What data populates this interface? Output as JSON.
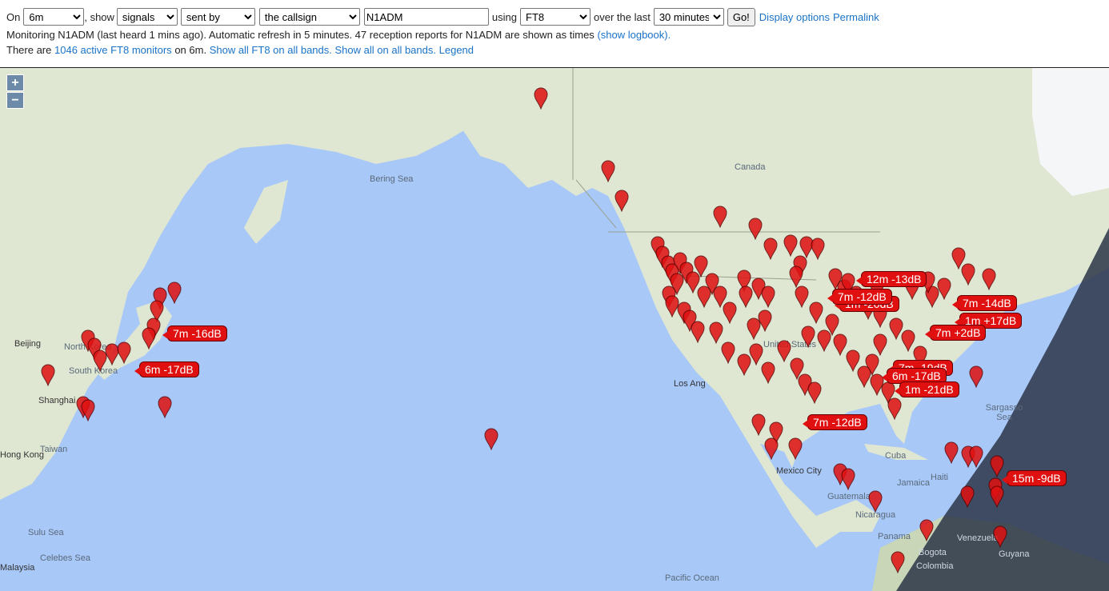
{
  "toolbar": {
    "on_label": "On",
    "band_value": "6m",
    "show_label": ", show",
    "mode_value": "signals",
    "direction_value": "sent by",
    "target_value": "the callsign",
    "callsign_value": "N1ADM",
    "using_label": "using",
    "protocol_value": "FT8",
    "over_label": "over the last",
    "period_value": "30 minutes",
    "go_label": "Go!",
    "display_options_label": "Display options",
    "permalink_label": "Permalink"
  },
  "status": {
    "line1_text": "Monitoring N1ADM (last heard 1 mins ago). Automatic refresh in 5 minutes. 47 reception reports for N1ADM are shown as times",
    "show_logbook_label": "(show logbook).",
    "line2_prefix": "There are",
    "active_monitors_link": "1046 active FT8 monitors",
    "line2_mid": "on 6m.",
    "show_all_ft8_link": "Show all FT8 on all bands.",
    "show_all_link": "Show all on all bands.",
    "legend_link": "Legend"
  },
  "map": {
    "zoom_in": "+",
    "zoom_out": "−",
    "labels": [
      "Canada",
      "Bering Sea",
      "Beijing",
      "Shanghai",
      "Hong Kong",
      "Taiwan",
      "Sulu Sea",
      "Celebes Sea",
      "Malaysia",
      "Los Ang",
      "Mexico City",
      "Cuba",
      "Haiti",
      "Jamaica",
      "Sargasso Sea",
      "Panama",
      "Venezuela",
      "Colombia",
      "Guyana",
      "Bogota",
      "Pacific Ocean",
      "Guatemala",
      "Nicaragua",
      "South Korea",
      "North Korea",
      "United States"
    ],
    "tags": [
      "7m -16dB",
      "6m -17dB",
      "12m -13dB",
      "1m -20dB",
      "7m -14dB",
      "1m +17dB",
      "7m +2dB",
      "6m -17dB",
      "1m -21dB",
      "7m -12dB",
      "15m -9dB",
      "7m -19dB",
      "7m -12dB"
    ],
    "colors": {
      "ocean": "#a8c8f8",
      "land": "#dfe6d2",
      "marker": "#e01010",
      "night": "#2b3548"
    }
  }
}
